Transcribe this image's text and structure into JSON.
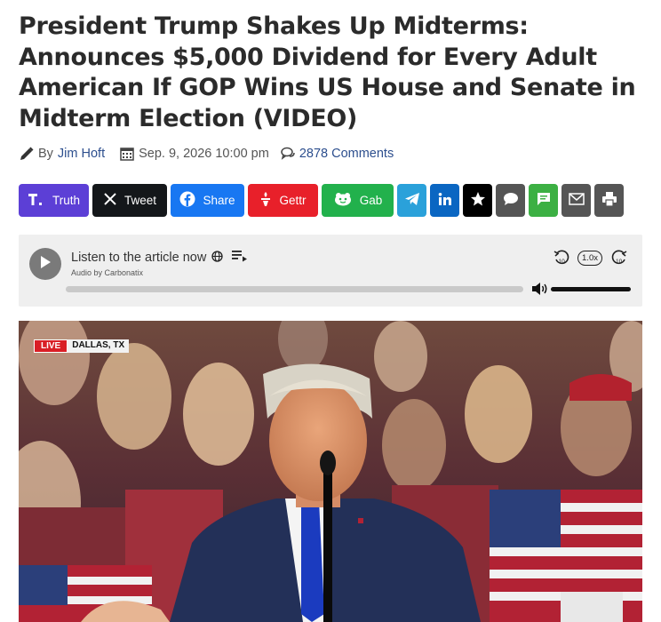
{
  "article": {
    "headline": "President Trump Shakes Up Midterms: Announces $5,000 Dividend for Every Adult American If GOP Wins US House and Senate in Midterm Election (VIDEO)",
    "by_label": "By",
    "author": "Jim Hoft",
    "date": "Sep. 9, 2026 10:00 pm",
    "comments": "2878 Comments"
  },
  "share": {
    "buttons": [
      {
        "label": "Truth",
        "icon": "truth-social-icon",
        "color": "#5c3fd6"
      },
      {
        "label": "Tweet",
        "icon": "x-icon",
        "color": "#14171a"
      },
      {
        "label": "Share",
        "icon": "facebook-icon",
        "color": "#1877f2"
      },
      {
        "label": "Gettr",
        "icon": "gettr-icon",
        "color": "#e8202a"
      },
      {
        "label": "Gab",
        "icon": "gab-icon",
        "color": "#22b14c"
      }
    ],
    "icon_buttons": [
      {
        "icon": "telegram-icon",
        "color": "#2aa1da"
      },
      {
        "icon": "linkedin-icon",
        "color": "#0a66c2"
      },
      {
        "icon": "star-icon",
        "color": "#000000"
      },
      {
        "icon": "comment-icon",
        "color": "#555555"
      },
      {
        "icon": "sms-icon",
        "color": "#3cb043"
      },
      {
        "icon": "email-icon",
        "color": "#555555"
      },
      {
        "icon": "print-icon",
        "color": "#555555"
      }
    ]
  },
  "player": {
    "title": "Listen to the article now",
    "subtitle": "Audio by Carbonatix",
    "speed": "1.0x",
    "rewind_seconds": "10",
    "forward_seconds": "10",
    "progress_fraction": 0,
    "volume_fraction": 1
  },
  "video": {
    "live_label": "LIVE",
    "location": "DALLAS, TX"
  }
}
